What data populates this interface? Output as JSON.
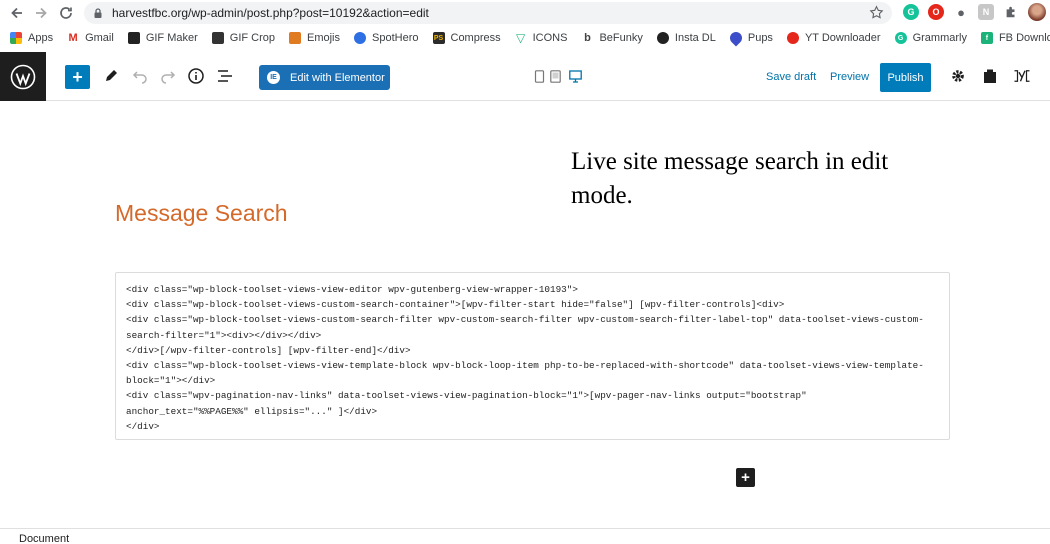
{
  "browser": {
    "url": "harvestfbc.org/wp-admin/post.php?post=10192&action=edit",
    "bookmarks": [
      {
        "label": "Apps",
        "icon": "apps-grid-icon",
        "color": "#ea4335"
      },
      {
        "label": "Gmail",
        "icon": "gmail-icon",
        "color": "#d93025"
      },
      {
        "label": "GIF Maker",
        "icon": "gif-maker-icon",
        "color": "#222222"
      },
      {
        "label": "GIF Crop",
        "icon": "gif-crop-icon",
        "color": "#333333"
      },
      {
        "label": "Emojis",
        "icon": "emojis-icon",
        "color": "#e07b22"
      },
      {
        "label": "SpotHero",
        "icon": "spothero-icon",
        "color": "#2f6fe4"
      },
      {
        "label": "Compress",
        "icon": "compress-icon",
        "color": "#2b2b2b"
      },
      {
        "label": "ICONS",
        "icon": "icons-icon",
        "color": "#2ab57d"
      },
      {
        "label": "BeFunky",
        "icon": "befunky-icon",
        "color": "#444444"
      },
      {
        "label": "Insta DL",
        "icon": "insta-dl-icon",
        "color": "#222222"
      },
      {
        "label": "Pups",
        "icon": "pups-icon",
        "color": "#3c4ec9"
      },
      {
        "label": "YT Downloader",
        "icon": "yt-downloader-icon",
        "color": "#e5261b"
      },
      {
        "label": "Grammarly",
        "icon": "grammarly-icon",
        "color": "#15c39a"
      },
      {
        "label": "FB Download",
        "icon": "fb-download-icon",
        "color": "#1bb37a"
      }
    ]
  },
  "toolbar": {
    "elementor_label": "Edit with Elementor",
    "save_draft_label": "Save draft",
    "preview_label": "Preview",
    "publish_label": "Publish"
  },
  "editor": {
    "overlay_note": "Live site message search in edit mode.",
    "title": "Message Search",
    "code_lines": [
      "<div class=\"wp-block-toolset-views-view-editor wpv-gutenberg-view-wrapper-10193\">",
      "<div class=\"wp-block-toolset-views-custom-search-container\">[wpv-filter-start hide=\"false\"] [wpv-filter-controls]<div>",
      "<div class=\"wp-block-toolset-views-custom-search-filter wpv-custom-search-filter wpv-custom-search-filter-label-top\" data-toolset-views-custom-",
      "search-filter=\"1\"><div></div></div>",
      "</div>[/wpv-filter-controls] [wpv-filter-end]</div>",
      "<div class=\"wp-block-toolset-views-view-template-block wpv-block-loop-item php-to-be-replaced-with-shortcode\" data-toolset-views-view-template-",
      "block=\"1\"></div>",
      "<div class=\"wpv-pagination-nav-links\" data-toolset-views-view-pagination-block=\"1\">[wpv-pager-nav-links output=\"bootstrap\"",
      "anchor_text=\"%%PAGE%%\" ellipsis=\"...\" ]</div>",
      "</div>"
    ]
  },
  "footer": {
    "breadcrumb": "Document"
  },
  "colors": {
    "wp_blue": "#007cba",
    "elementor_blue": "#1b6fb5",
    "title_orange": "#d4692a",
    "link_blue": "#0073aa"
  }
}
